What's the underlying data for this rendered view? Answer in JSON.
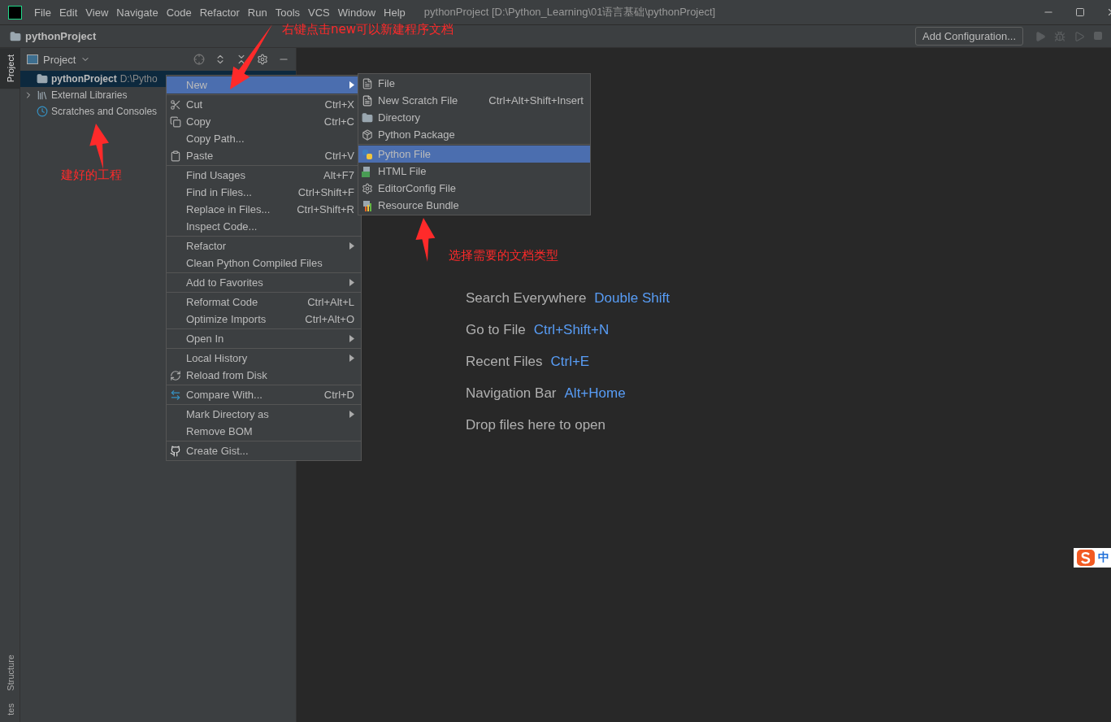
{
  "title_bar": {
    "menus": [
      "File",
      "Edit",
      "View",
      "Navigate",
      "Code",
      "Refactor",
      "Run",
      "Tools",
      "VCS",
      "Window",
      "Help"
    ],
    "title": "pythonProject [D:\\Python_Learning\\01语言基础\\pythonProject]"
  },
  "nav_bar": {
    "breadcrumb": "pythonProject",
    "add_configuration": "Add Configuration..."
  },
  "side_tabs_top": [
    {
      "label": "Project",
      "selected": true
    }
  ],
  "side_tabs_bottom": [
    {
      "label": "Structure",
      "selected": false
    },
    {
      "label": "tes",
      "selected": false
    }
  ],
  "project_panel": {
    "title": "Project",
    "tree": [
      {
        "label": "pythonProject",
        "path": "D:\\Pytho",
        "kind": "folder",
        "selected": true,
        "expandable": false
      },
      {
        "label": "External Libraries",
        "kind": "libraries",
        "selected": false,
        "expandable": true
      },
      {
        "label": "Scratches and Consoles",
        "kind": "scratches",
        "selected": false,
        "expandable": false
      }
    ]
  },
  "context_menu": {
    "groups": [
      [
        {
          "label": "New",
          "submenu": true,
          "selected": true
        }
      ],
      [
        {
          "label": "Cut",
          "shortcut": "Ctrl+X",
          "kind": "cut",
          "submenu": false,
          "selected": false
        },
        {
          "label": "Copy",
          "shortcut": "Ctrl+C",
          "kind": "copy",
          "submenu": false,
          "selected": false
        },
        {
          "label": "Copy Path...",
          "submenu": false,
          "selected": false
        },
        {
          "label": "Paste",
          "shortcut": "Ctrl+V",
          "kind": "paste",
          "submenu": false,
          "selected": false
        }
      ],
      [
        {
          "label": "Find Usages",
          "shortcut": "Alt+F7",
          "submenu": false,
          "selected": false
        },
        {
          "label": "Find in Files...",
          "shortcut": "Ctrl+Shift+F",
          "submenu": false,
          "selected": false
        },
        {
          "label": "Replace in Files...",
          "shortcut": "Ctrl+Shift+R",
          "submenu": false,
          "selected": false
        },
        {
          "label": "Inspect Code...",
          "submenu": false,
          "selected": false
        }
      ],
      [
        {
          "label": "Refactor",
          "submenu": true,
          "selected": false
        },
        {
          "label": "Clean Python Compiled Files",
          "submenu": false,
          "selected": false
        }
      ],
      [
        {
          "label": "Add to Favorites",
          "submenu": true,
          "selected": false
        }
      ],
      [
        {
          "label": "Reformat Code",
          "shortcut": "Ctrl+Alt+L",
          "submenu": false,
          "selected": false
        },
        {
          "label": "Optimize Imports",
          "shortcut": "Ctrl+Alt+O",
          "submenu": false,
          "selected": false
        }
      ],
      [
        {
          "label": "Open In",
          "submenu": true,
          "selected": false
        }
      ],
      [
        {
          "label": "Local History",
          "submenu": true,
          "selected": false
        },
        {
          "label": "Reload from Disk",
          "kind": "reload",
          "submenu": false,
          "selected": false
        }
      ],
      [
        {
          "label": "Compare With...",
          "shortcut": "Ctrl+D",
          "kind": "compare",
          "submenu": false,
          "selected": false
        }
      ],
      [
        {
          "label": "Mark Directory as",
          "submenu": true,
          "selected": false
        },
        {
          "label": "Remove BOM",
          "submenu": false,
          "selected": false
        }
      ],
      [
        {
          "label": "Create Gist...",
          "kind": "github",
          "submenu": false,
          "selected": false
        }
      ]
    ]
  },
  "new_submenu": {
    "groups": [
      [
        {
          "label": "File",
          "kind": "file",
          "selected": false
        },
        {
          "label": "New Scratch File",
          "shortcut": "Ctrl+Alt+Shift+Insert",
          "kind": "scratch",
          "selected": false
        },
        {
          "label": "Directory",
          "kind": "folder",
          "selected": false
        },
        {
          "label": "Python Package",
          "kind": "package",
          "selected": false
        }
      ],
      [
        {
          "label": "Python File",
          "kind": "python",
          "selected": true
        },
        {
          "label": "HTML File",
          "kind": "html",
          "selected": false
        },
        {
          "label": "EditorConfig File",
          "kind": "gear",
          "selected": false
        },
        {
          "label": "Resource Bundle",
          "kind": "bundle",
          "selected": false
        }
      ]
    ]
  },
  "editor_hints": [
    {
      "label": "Search Everywhere",
      "shortcut": "Double Shift"
    },
    {
      "label": "Go to File",
      "shortcut": "Ctrl+Shift+N"
    },
    {
      "label": "Recent Files",
      "shortcut": "Ctrl+E"
    },
    {
      "label": "Navigation Bar",
      "shortcut": "Alt+Home"
    },
    {
      "label": "Drop files here to open"
    }
  ],
  "ime_indicator": "中",
  "annotations": [
    {
      "text": "右键点击new可以新建程序文档",
      "kind": "menu-hint"
    },
    {
      "text": "建好的工程",
      "kind": "project-hint"
    },
    {
      "text": "选择需要的文档类型",
      "kind": "type-hint"
    }
  ]
}
